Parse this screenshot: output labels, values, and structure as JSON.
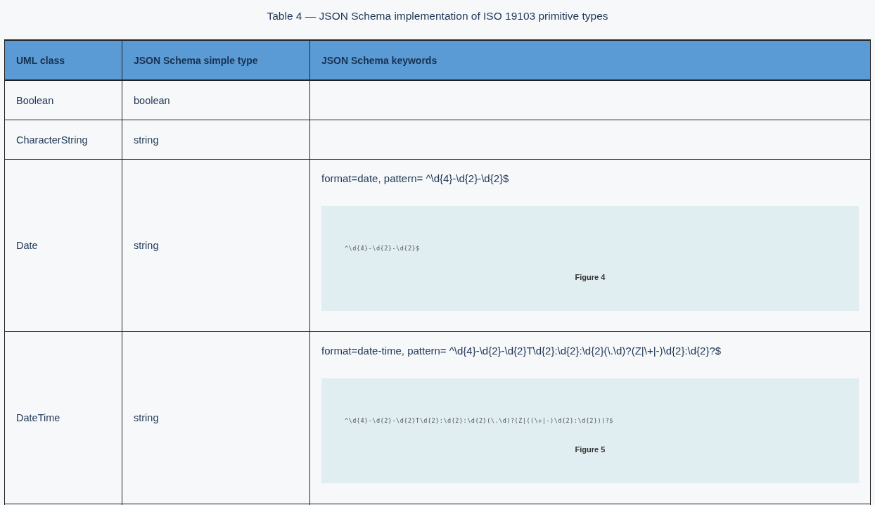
{
  "caption": "Table 4 — JSON Schema implementation of ISO 19103 primitive types",
  "table": {
    "columns": [
      "UML class",
      "JSON Schema simple type",
      "JSON Schema keywords"
    ],
    "rows": [
      {
        "uml_class": "Boolean",
        "simple_type": "boolean"
      },
      {
        "uml_class": "CharacterString",
        "simple_type": "string"
      },
      {
        "uml_class": "Date",
        "simple_type": "string",
        "keywords": {
          "text": "format=date, pattern= ^\\d{4}-\\d{2}-\\d{2}$",
          "figure": {
            "code": "^\\d{4}-\\d{2}-\\d{2}$",
            "caption": "Figure 4"
          }
        }
      },
      {
        "uml_class": "DateTime",
        "simple_type": "string",
        "keywords": {
          "text": "format=date-time, pattern= ^\\d{4}-\\d{2}-\\d{2}T\\d{2}:\\d{2}:\\d{2}(\\.\\d)?(Z|\\+|-)\\d{2}:\\d{2}?$",
          "figure": {
            "code": "^\\d{4}-\\d{2}-\\d{2}T\\d{2}:\\d{2}:\\d{2}(\\.\\d)?(Z|((\\+|-)\\d{2}:\\d{2}))?$",
            "caption": "Figure 5"
          }
        }
      }
    ]
  }
}
